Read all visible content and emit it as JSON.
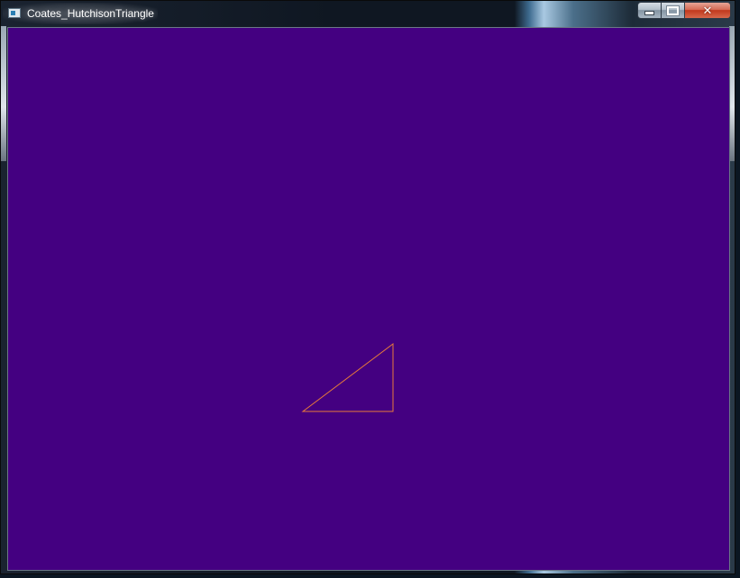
{
  "window": {
    "title": "Coates_HutchisonTriangle",
    "app_icon": "application-window-icon",
    "caption_buttons": {
      "minimize_icon": "minimize-icon",
      "maximize_icon": "maximize-icon",
      "close_icon": "close-icon",
      "close_glyph": "✕"
    }
  },
  "canvas": {
    "background_color": "#440081",
    "triangle_stroke_color": "#e87a3a"
  }
}
